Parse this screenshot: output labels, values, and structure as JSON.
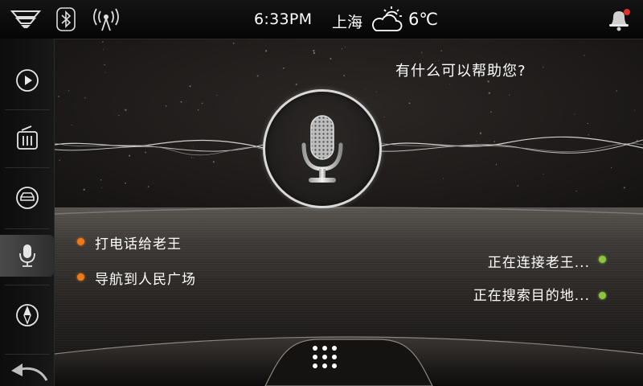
{
  "status_bar": {
    "time": "6:33PM",
    "city": "上海",
    "temperature": "6℃",
    "weather_icon": "partly-cloudy-icon",
    "icons": [
      "logo-icon",
      "bluetooth-icon",
      "signal-icon",
      "notification-bell-icon"
    ],
    "notification_dot_color": "#e0302a"
  },
  "sidebar": {
    "items": [
      {
        "name": "media-play",
        "icon": "play-icon"
      },
      {
        "name": "radio",
        "icon": "radio-icon"
      },
      {
        "name": "car",
        "icon": "car-icon"
      },
      {
        "name": "voice",
        "icon": "microphone-icon",
        "active": true
      },
      {
        "name": "navigation",
        "icon": "compass-icon"
      },
      {
        "name": "back",
        "icon": "back-arrow-icon"
      }
    ]
  },
  "assistant": {
    "prompt": "有什么可以帮助您?",
    "mic_icon": "microphone-icon",
    "commands": [
      {
        "text": "打电话给老王",
        "dot_color": "#f07a1a"
      },
      {
        "text": "导航到人民广场",
        "dot_color": "#f07a1a"
      }
    ],
    "responses": [
      {
        "text": "正在连接老王...",
        "dot_color": "#8cc63f"
      },
      {
        "text": "正在搜索目的地...",
        "dot_color": "#8cc63f"
      }
    ]
  },
  "dock": {
    "menu_icon": "app-grid-icon"
  }
}
